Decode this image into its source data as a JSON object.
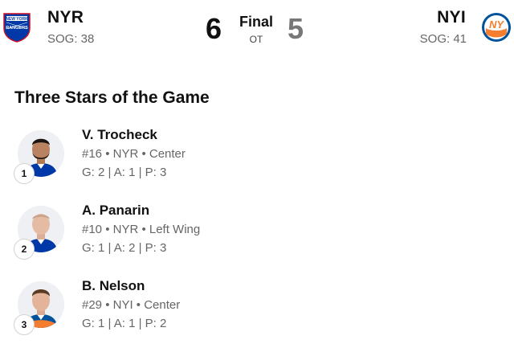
{
  "game": {
    "home": {
      "abbr": "NYR",
      "sog": "SOG: 38",
      "score": "6",
      "logo_icon": "rangers-logo-icon",
      "logo_text": "NEW YORK RANGERS"
    },
    "away": {
      "abbr": "NYI",
      "sog": "SOG: 41",
      "score": "5",
      "logo_icon": "islanders-logo-icon",
      "logo_text": "NY"
    },
    "status": "Final",
    "period": "OT"
  },
  "three_stars": {
    "title": "Three Stars of the Game",
    "players": [
      {
        "rank": "1",
        "name": "V. Trocheck",
        "info": "#16 • NYR • Center",
        "stats": "G: 2 | A: 1 | P: 3"
      },
      {
        "rank": "2",
        "name": "A. Panarin",
        "info": "#10 • NYR • Left Wing",
        "stats": "G: 1 | A: 2 | P: 3"
      },
      {
        "rank": "3",
        "name": "B. Nelson",
        "info": "#29 • NYI • Center",
        "stats": "G: 1 | A: 1 | P: 2"
      }
    ]
  },
  "colors": {
    "rangers_blue": "#0038a8",
    "rangers_red": "#ce1126",
    "islanders_blue": "#00539b",
    "islanders_orange": "#f47d30",
    "secondary_text": "#666666"
  }
}
